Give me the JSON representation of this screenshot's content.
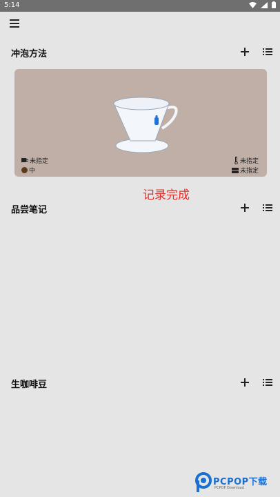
{
  "status_bar": {
    "time": "5:14",
    "icons": [
      "wifi-icon",
      "signal-icon",
      "battery-icon"
    ]
  },
  "toolbar": {
    "menu_icon": "hamburger-menu-icon"
  },
  "sections": {
    "brew_method": {
      "title": "冲泡方法",
      "add_icon": "plus-icon",
      "list_icon": "list-icon"
    },
    "tasting_notes": {
      "title": "品尝笔记",
      "add_icon": "plus-icon",
      "list_icon": "list-icon"
    },
    "green_beans": {
      "title": "生咖啡豆",
      "add_icon": "plus-icon",
      "list_icon": "list-icon"
    }
  },
  "brew_card": {
    "illustration": "pour-over-dripper-icon",
    "cup_value": "未指定",
    "roast_value": "中",
    "temperature_value": "未指定",
    "grind_value": "未指定"
  },
  "record_done_text": "记录完成",
  "watermark": {
    "brand": "PCPOP下载",
    "sub": "PCPOP Download"
  },
  "colors": {
    "background": "#e5e5e5",
    "card": "#bfafa7",
    "accent_red": "#e0302c",
    "brand_blue": "#1a6fd1"
  }
}
